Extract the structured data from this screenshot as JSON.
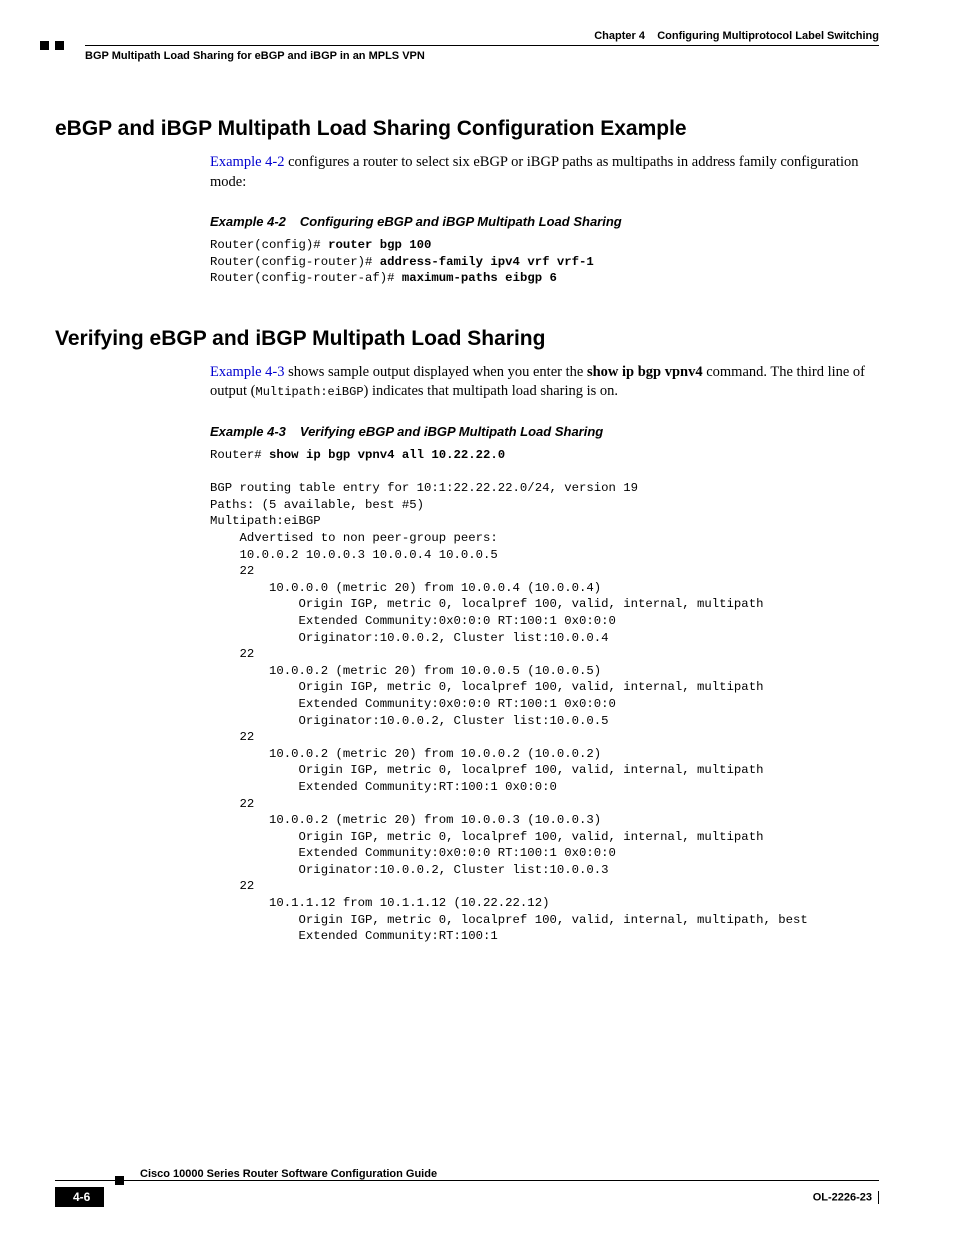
{
  "header": {
    "chapter_label": "Chapter 4",
    "chapter_title": "Configuring Multiprotocol Label Switching",
    "section_path": "BGP Multipath Load Sharing for eBGP and iBGP in an MPLS VPN"
  },
  "sections": {
    "s1": {
      "heading": "eBGP and iBGP Multipath Load Sharing Configuration Example",
      "intro_link": "Example 4-2",
      "intro_rest": " configures a router to select six eBGP or iBGP paths as multipaths in address family configuration mode:",
      "example_num": "Example 4-2",
      "example_title": "Configuring eBGP and iBGP Multipath Load Sharing",
      "code_p1": "Router(config)# ",
      "code_b1": "router bgp 100",
      "code_p2": "Router(config-router)# ",
      "code_b2": "address-family ipv4 vrf vrf-1",
      "code_p3": "Router(config-router-af)# ",
      "code_b3": "maximum-paths eibgp 6"
    },
    "s2": {
      "heading": "Verifying eBGP and iBGP Multipath Load Sharing",
      "intro_link": "Example 4-3",
      "intro_mid1": " shows sample output displayed when you enter the ",
      "intro_bold": "show ip bgp vpnv4",
      "intro_mid2": " command. The third line of output (",
      "intro_code": "Multipath:eiBGP",
      "intro_end": ") indicates that multipath load sharing is on.",
      "example_num": "Example 4-3",
      "example_title": "Verifying eBGP and iBGP Multipath Load Sharing",
      "code_prompt": "Router# ",
      "code_cmd": "show ip bgp vpnv4 all 10.22.22.0",
      "code_body": "\nBGP routing table entry for 10:1:22.22.22.0/24, version 19\nPaths: (5 available, best #5)\nMultipath:eiBGP\n    Advertised to non peer-group peers:\n    10.0.0.2 10.0.0.3 10.0.0.4 10.0.0.5\n    22\n        10.0.0.0 (metric 20) from 10.0.0.4 (10.0.0.4)\n            Origin IGP, metric 0, localpref 100, valid, internal, multipath\n            Extended Community:0x0:0:0 RT:100:1 0x0:0:0\n            Originator:10.0.0.2, Cluster list:10.0.0.4\n    22\n        10.0.0.2 (metric 20) from 10.0.0.5 (10.0.0.5)\n            Origin IGP, metric 0, localpref 100, valid, internal, multipath\n            Extended Community:0x0:0:0 RT:100:1 0x0:0:0\n            Originator:10.0.0.2, Cluster list:10.0.0.5\n    22\n        10.0.0.2 (metric 20) from 10.0.0.2 (10.0.0.2)\n            Origin IGP, metric 0, localpref 100, valid, internal, multipath\n            Extended Community:RT:100:1 0x0:0:0\n    22\n        10.0.0.2 (metric 20) from 10.0.0.3 (10.0.0.3)\n            Origin IGP, metric 0, localpref 100, valid, internal, multipath\n            Extended Community:0x0:0:0 RT:100:1 0x0:0:0\n            Originator:10.0.0.2, Cluster list:10.0.0.3\n    22\n        10.1.1.12 from 10.1.1.12 (10.22.22.12)\n            Origin IGP, metric 0, localpref 100, valid, internal, multipath, best\n            Extended Community:RT:100:1"
    }
  },
  "footer": {
    "guide_title": "Cisco 10000 Series Router Software Configuration Guide",
    "page_number": "4-6",
    "doc_id": "OL-2226-23"
  }
}
